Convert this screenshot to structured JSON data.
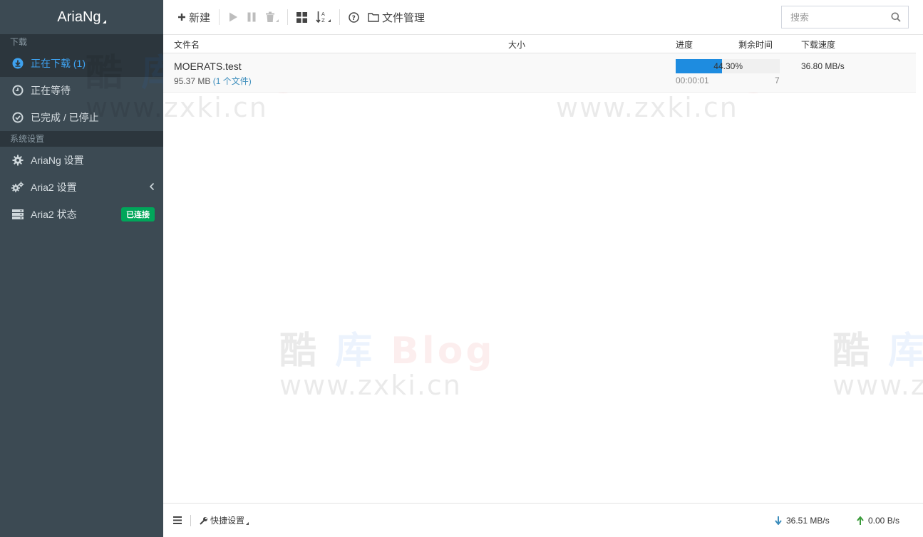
{
  "app": {
    "brand": "AriaNg"
  },
  "sidebar": {
    "download_header": "下载",
    "items": [
      {
        "label": "正在下载 (1)",
        "icon": "download-circle-icon",
        "active": true
      },
      {
        "label": "正在等待",
        "icon": "clock-icon"
      },
      {
        "label": "已完成 / 已停止",
        "icon": "check-circle-icon"
      }
    ],
    "settings_header": "系统设置",
    "settings_items": [
      {
        "label": "AriaNg 设置",
        "icon": "gear-icon"
      },
      {
        "label": "Aria2 设置",
        "icon": "gears-icon"
      },
      {
        "label": "Aria2 状态",
        "icon": "server-icon",
        "badge": "已连接",
        "badge_color": "#00a65a"
      }
    ]
  },
  "toolbar": {
    "new_label": "新建",
    "file_manager_label": "文件管理",
    "search_placeholder": "搜索"
  },
  "table": {
    "headers": {
      "name": "文件名",
      "size": "大小",
      "progress": "进度",
      "remaining": "剩余时间",
      "speed": "下载速度"
    },
    "rows": [
      {
        "name": "MOERATS.test",
        "size": "95.37 MB",
        "files": "(1 个文件)",
        "progress": "44.30%",
        "progress_value": 0.443,
        "elapsed": "00:00:01",
        "connections": "7",
        "speed": "36.80 MB/s"
      }
    ]
  },
  "watermark": {
    "line1_a": "酷",
    "line1_b": "库",
    "line1_c": "Blog",
    "line2": "www.zxki.cn"
  },
  "footer": {
    "quick_settings": "快捷设置",
    "down_speed": "36.51 MB/s",
    "up_speed": "0.00 B/s"
  },
  "colors": {
    "accent": "#3ea2f0",
    "sidebar_bg": "#3c4a53",
    "progress": "#1e8ce0",
    "badge": "#00a65a"
  }
}
